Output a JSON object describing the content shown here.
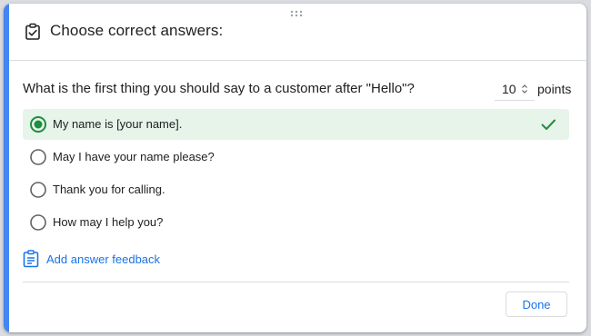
{
  "header": {
    "title": "Choose correct answers:",
    "icon": "assignment-check-icon"
  },
  "question": {
    "text": "What is the first thing you should say to a customer after \"Hello\"?",
    "points_value": "10",
    "points_label": "points"
  },
  "options": [
    {
      "label": "My name is [your name].",
      "selected": true,
      "correct": true
    },
    {
      "label": "May I have your name please?",
      "selected": false,
      "correct": false
    },
    {
      "label": "Thank you for calling.",
      "selected": false,
      "correct": false
    },
    {
      "label": "How may I help you?",
      "selected": false,
      "correct": false
    }
  ],
  "feedback": {
    "label": "Add answer feedback",
    "icon": "feedback-clipboard-icon"
  },
  "footer": {
    "done_label": "Done"
  },
  "colors": {
    "accent": "#4285f4",
    "correct_fill": "#e6f4ea",
    "correct_green": "#1e8e3e",
    "link_blue": "#1a73e8"
  }
}
